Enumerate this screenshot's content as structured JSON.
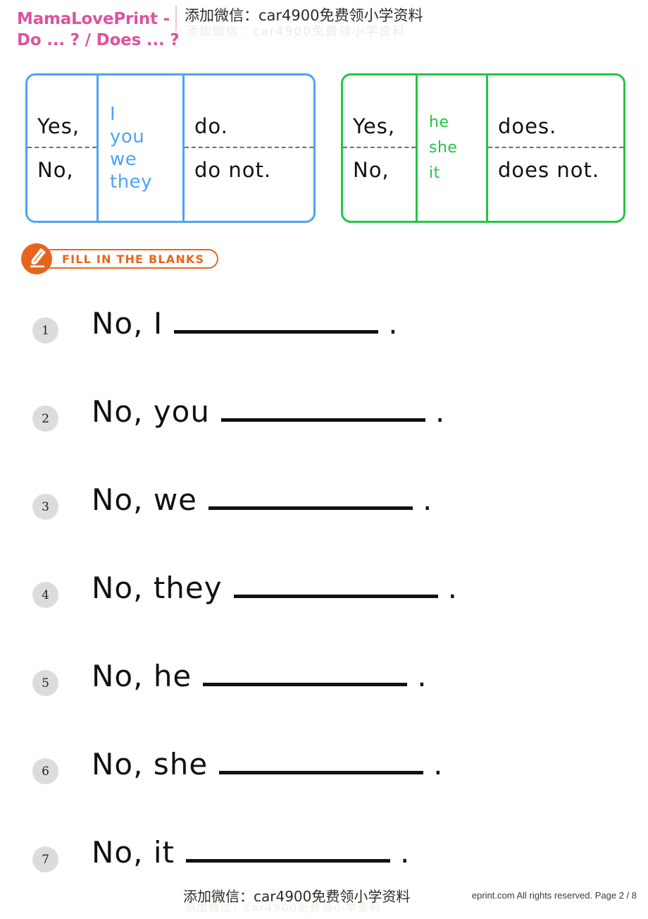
{
  "header": {
    "title_line1": "MamaLovePrint - ",
    "title_line2": "Do ... ? / Does ... ?",
    "title_color": "#dd52a0"
  },
  "watermark": {
    "text": "添加微信：car4900免费领小学资料",
    "ghost_text": "添加微信：car4900免费领小学资料"
  },
  "grammar_boxes": [
    {
      "accent_color": "#4da3f5",
      "rows": [
        {
          "lead": "Yes,",
          "answer": "do."
        },
        {
          "lead": "No,",
          "answer": "do not."
        }
      ],
      "pronouns": [
        "I",
        "you",
        "we",
        "they"
      ]
    },
    {
      "accent_color": "#22c543",
      "rows": [
        {
          "lead": "Yes,",
          "answer": "does."
        },
        {
          "lead": "No,",
          "answer": "does not."
        }
      ],
      "pronouns": [
        "he",
        "she",
        "it"
      ]
    }
  ],
  "section": {
    "badge_label": "FILL IN THE BLANKS",
    "badge_color": "#e8641c",
    "icon": "pencil-icon"
  },
  "questions": [
    {
      "number": "1",
      "stem": "No, I",
      "punct": "."
    },
    {
      "number": "2",
      "stem": "No, you",
      "punct": "."
    },
    {
      "number": "3",
      "stem": "No, we",
      "punct": "."
    },
    {
      "number": "4",
      "stem": "No, they",
      "punct": "."
    },
    {
      "number": "5",
      "stem": "No, he",
      "punct": "."
    },
    {
      "number": "6",
      "stem": "No, she",
      "punct": "."
    },
    {
      "number": "7",
      "stem": "No, it",
      "punct": "."
    }
  ],
  "footer": {
    "copyright": "eprint.com All rights reserved. Page 2 / 8"
  }
}
